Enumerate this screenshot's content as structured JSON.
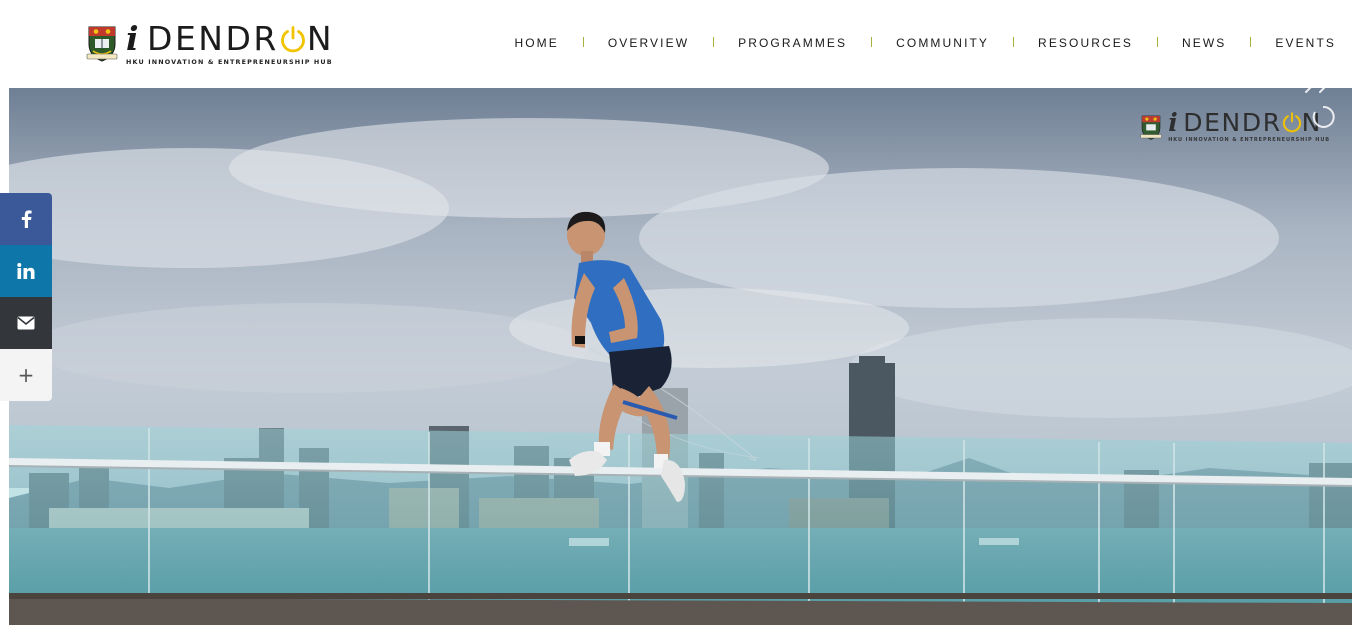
{
  "brand": {
    "logo_word": "DENDR",
    "logo_i": "i",
    "logo_word_end": "N",
    "logo_tagline": "HKU INNOVATION & ENTREPRENEURSHIP HUB"
  },
  "nav": {
    "items": [
      {
        "label": "HOME"
      },
      {
        "label": "OVERVIEW"
      },
      {
        "label": "PROGRAMMES"
      },
      {
        "label": "COMMUNITY"
      },
      {
        "label": "RESOURCES"
      },
      {
        "label": "NEWS"
      },
      {
        "label": "EVENTS"
      }
    ]
  },
  "hero": {
    "watermark_word": "DENDR",
    "watermark_i": "i",
    "watermark_word_end": "N",
    "watermark_tagline": "HKU INNOVATION & ENTREPRENEURSHIP HUB"
  },
  "share": {
    "buttons": [
      {
        "icon": "facebook-icon"
      },
      {
        "icon": "linkedin-icon"
      },
      {
        "icon": "email-icon"
      },
      {
        "icon": "plus-icon",
        "label": "+"
      }
    ]
  },
  "colors": {
    "accent_yellow": "#f2c300",
    "nav_separator": "#a6b23a",
    "facebook": "#3b5998",
    "linkedin": "#0e76a8",
    "email": "#33373b"
  }
}
